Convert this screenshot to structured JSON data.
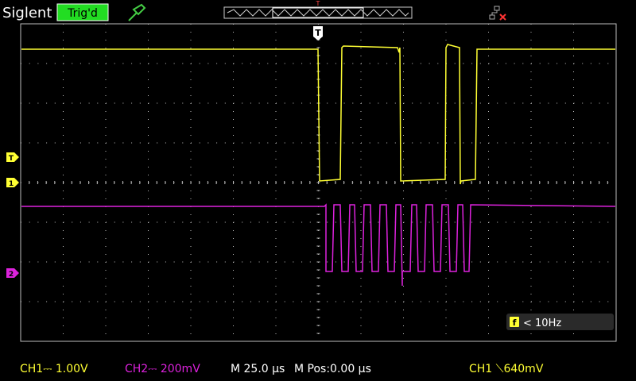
{
  "brand": "Siglent",
  "trigger_status": "Trig'd",
  "trigger_marker": "T",
  "channels": {
    "ch1": {
      "marker": "1",
      "color": "#ffff33"
    },
    "ch2": {
      "marker": "2",
      "color": "#dd22dd"
    }
  },
  "trigger_level_marker": "T",
  "frequency_readout": "< 10Hz",
  "frequency_icon_letter": "f",
  "status_bar": {
    "ch1_scale": "CH1⎓ 1.00V",
    "ch2_scale": "CH2⎓ 200mV",
    "timebase": "M 25.0 µs",
    "mpos": "M Pos:0.00 µs",
    "trigger_info": "CH1 ⟍640mV"
  },
  "colors": {
    "background": "#000000",
    "grid_dot": "#bdbdbd",
    "trigger_badge_bg": "#22dd22",
    "ch1": "#ffff33",
    "ch2": "#dd22dd",
    "accent_icon": "#44cc44",
    "error_red": "#ff3333"
  },
  "icons": {
    "probe": "probe-icon",
    "network": "network-error-icon",
    "memory": "memory-overview-icon"
  }
}
